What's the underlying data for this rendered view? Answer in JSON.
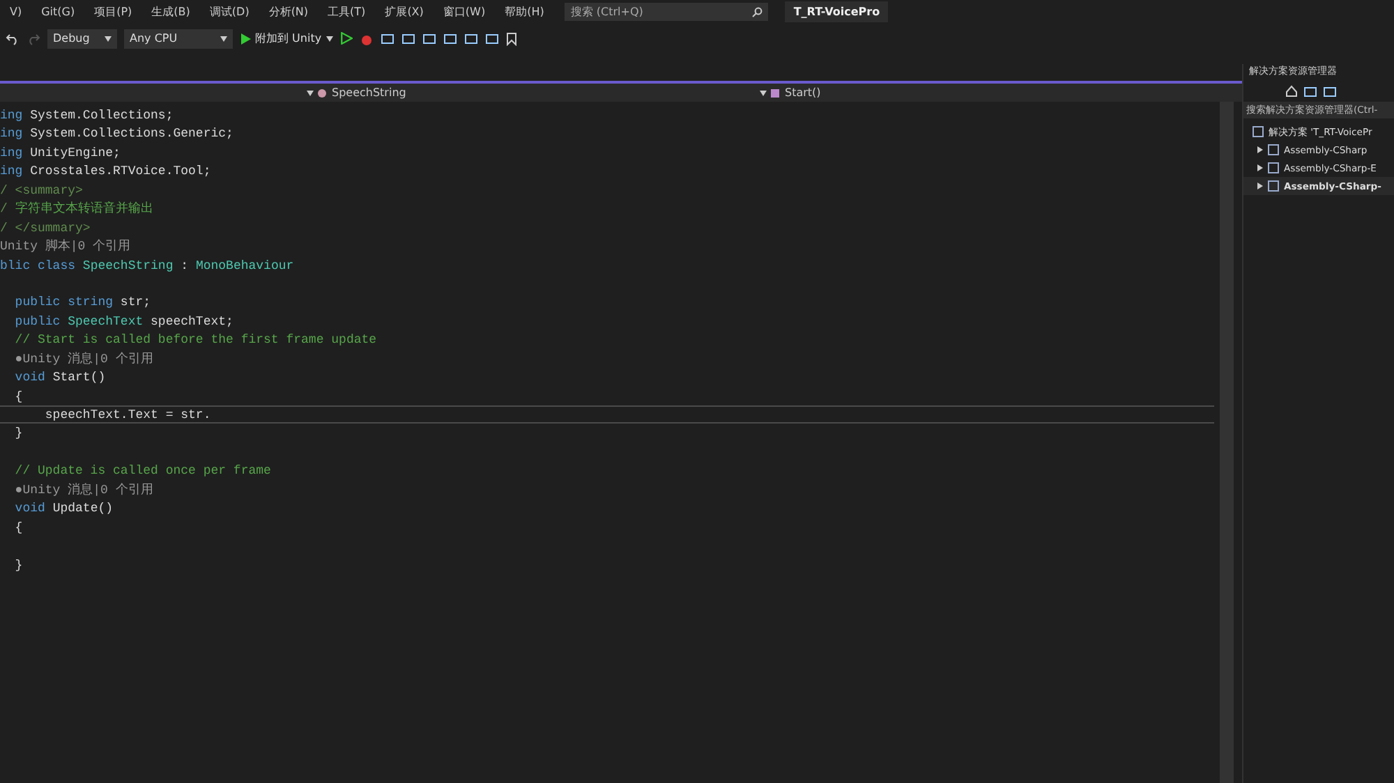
{
  "menu": [
    "V)",
    "Git(G)",
    "项目(P)",
    "生成(B)",
    "调试(D)",
    "分析(N)",
    "工具(T)",
    "扩展(X)",
    "窗口(W)",
    "帮助(H)"
  ],
  "search": {
    "placeholder": "搜索 (Ctrl+Q)"
  },
  "window": {
    "title": "T_RT-VoicePro"
  },
  "toolbar": {
    "configuration": "Debug",
    "platform": "Any CPU",
    "run": "附加到 Unity"
  },
  "navbar": {
    "class": "SpeechString",
    "member": "Start()"
  },
  "code": [
    {
      "current": false,
      "tokens": [
        {
          "kind": "keyword",
          "text": "ing "
        },
        {
          "kind": "plain",
          "text": "System.Collections;"
        }
      ]
    },
    {
      "current": false,
      "tokens": [
        {
          "kind": "keyword",
          "text": "ing "
        },
        {
          "kind": "plain",
          "text": "System.Collections.Generic;"
        }
      ]
    },
    {
      "current": false,
      "tokens": [
        {
          "kind": "keyword",
          "text": "ing "
        },
        {
          "kind": "plain",
          "text": "UnityEngine;"
        }
      ]
    },
    {
      "current": false,
      "tokens": [
        {
          "kind": "keyword",
          "text": "ing "
        },
        {
          "kind": "plain",
          "text": "Crosstales.RTVoice.Tool;"
        }
      ]
    },
    {
      "current": false,
      "tokens": [
        {
          "kind": "doc",
          "text": "/ <summary>"
        }
      ]
    },
    {
      "current": false,
      "tokens": [
        {
          "kind": "doc",
          "text": "/ "
        },
        {
          "kind": "comment",
          "text": "字符串文本转语音并输出"
        }
      ]
    },
    {
      "current": false,
      "tokens": [
        {
          "kind": "doc",
          "text": "/ </summary>"
        }
      ]
    },
    {
      "current": false,
      "tokens": [
        {
          "kind": "lens",
          "text": "Unity 脚本|0 个引用"
        }
      ]
    },
    {
      "current": false,
      "tokens": [
        {
          "kind": "keyword",
          "text": "blic class "
        },
        {
          "kind": "type",
          "text": "SpeechString"
        },
        {
          "kind": "plain",
          "text": " : "
        },
        {
          "kind": "type",
          "text": "MonoBehaviour"
        }
      ]
    },
    {
      "current": false
    },
    {
      "current": false,
      "tokens": [
        {
          "kind": "keyword",
          "text": "  public string "
        },
        {
          "kind": "plain",
          "text": "str;"
        }
      ]
    },
    {
      "current": false,
      "tokens": [
        {
          "kind": "keyword",
          "text": "  public "
        },
        {
          "kind": "type",
          "text": "SpeechText"
        },
        {
          "kind": "plain",
          "text": " speechText;"
        }
      ]
    },
    {
      "current": false,
      "tokens": [
        {
          "kind": "comment",
          "text": "  // Start is called before the first frame update"
        }
      ]
    },
    {
      "current": false,
      "tokens": [
        {
          "kind": "lens",
          "text": "  ●Unity 消息|0 个引用"
        }
      ]
    },
    {
      "current": false,
      "tokens": [
        {
          "kind": "keyword",
          "text": "  void "
        },
        {
          "kind": "plain",
          "text": "Start()"
        }
      ]
    },
    {
      "current": false,
      "tokens": [
        {
          "kind": "plain",
          "text": "  {"
        }
      ]
    },
    {
      "current": true,
      "tokens": [
        {
          "kind": "plain",
          "text": "      speechText.Text = str."
        }
      ]
    },
    {
      "current": false,
      "tokens": [
        {
          "kind": "plain",
          "text": "  }"
        }
      ]
    },
    {
      "current": false
    },
    {
      "current": false,
      "tokens": [
        {
          "kind": "comment",
          "text": "  // Update is called once per frame"
        }
      ]
    },
    {
      "current": false,
      "tokens": [
        {
          "kind": "lens",
          "text": "  ●Unity 消息|0 个引用"
        }
      ]
    },
    {
      "current": false,
      "tokens": [
        {
          "kind": "keyword",
          "text": "  void "
        },
        {
          "kind": "plain",
          "text": "Update()"
        }
      ]
    },
    {
      "current": false,
      "tokens": [
        {
          "kind": "plain",
          "text": "  {"
        }
      ]
    },
    {
      "current": false
    },
    {
      "current": false,
      "tokens": [
        {
          "kind": "plain",
          "text": "  }"
        }
      ]
    }
  ],
  "solution_explorer": {
    "title": "解决方案资源管理器",
    "search": {
      "placeholder": "搜索解决方案资源管理器(Ctrl-"
    },
    "solution": "解决方案 'T_RT-VoicePr",
    "projects": [
      {
        "label": "Assembly-CSharp",
        "bold": false
      },
      {
        "label": "Assembly-CSharp-E",
        "bold": false
      },
      {
        "label": "Assembly-CSharp-",
        "bold": true
      }
    ]
  }
}
